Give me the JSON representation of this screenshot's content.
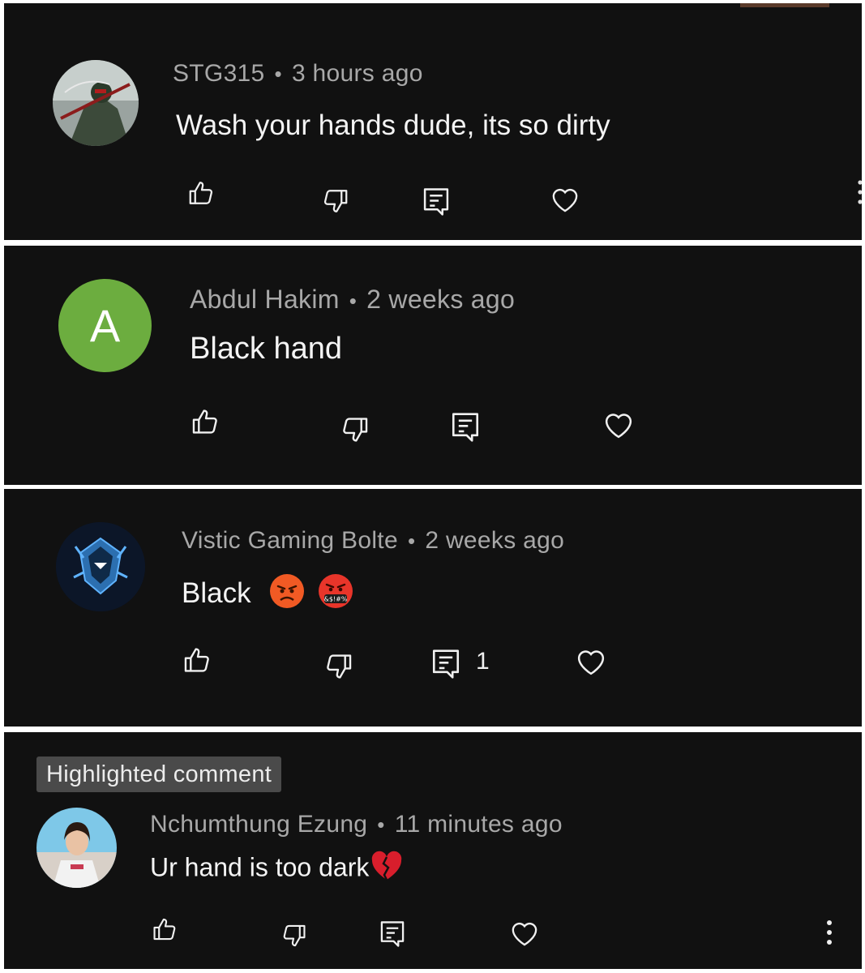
{
  "comments": [
    {
      "author": "STG315",
      "time": "3 hours ago",
      "text": "Wash your hands dude, its so dirty",
      "avatar": "game-character-avatar"
    },
    {
      "author": "Abdul Hakim",
      "time": "2 weeks ago",
      "text": "Black hand",
      "avatar_letter": "A",
      "avatar_color": "#6cad3f"
    },
    {
      "author": "Vistic Gaming Bolte",
      "time": "2 weeks ago",
      "text": "Black",
      "emoji": [
        "angry-face",
        "face-with-symbols-on-mouth"
      ],
      "reply_count": "1",
      "avatar": "gaming-logo-avatar"
    },
    {
      "badge": "Highlighted comment",
      "author": "Nchumthung Ezung",
      "time": "11 minutes ago",
      "text": "Ur hand is too dark",
      "emoji": [
        "broken-heart"
      ],
      "avatar": "photo-avatar"
    }
  ],
  "icons": [
    "thumbs-up-icon",
    "thumbs-down-icon",
    "reply-icon",
    "heart-icon",
    "more-vert-icon"
  ],
  "colors": {
    "background": "#111111",
    "meta": "#a8a8a8",
    "text": "#f4f4f4",
    "badge": "#4a4a4a"
  }
}
